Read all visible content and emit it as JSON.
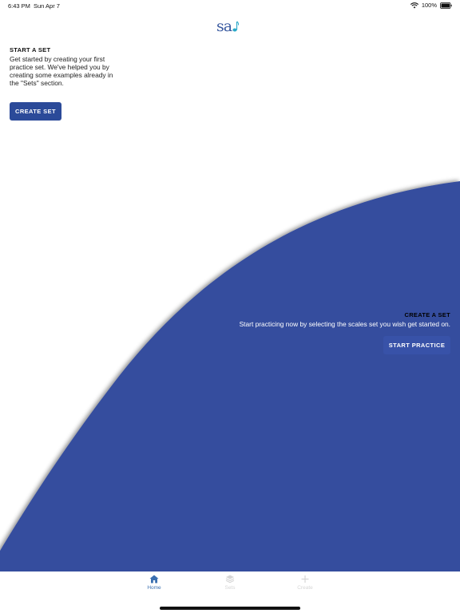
{
  "status_bar": {
    "time": "6:43 PM",
    "date": "Sun Apr 7",
    "battery": "100%"
  },
  "logo": {
    "text": "sa",
    "icon": "music-note-icon"
  },
  "start_set": {
    "title": "START A SET",
    "description": "Get started by creating your first practice set. We've helped you by creating some examples already in the \"Sets\" section.",
    "button_label": "CREATE SET"
  },
  "create_set": {
    "title": "CREATE A SET",
    "description": "Start practicing now by selecting the scales set you wish get started on.",
    "button_label": "START PRACTICE"
  },
  "tabs": [
    {
      "label": "Home",
      "icon": "home-icon",
      "active": true
    },
    {
      "label": "Sets",
      "icon": "sets-stack-icon",
      "active": false
    },
    {
      "label": "Create",
      "icon": "plus-icon",
      "active": false
    }
  ],
  "colors": {
    "wave": "#354d9e",
    "accent": "#3a6fb0",
    "button": "#2b4a99"
  }
}
